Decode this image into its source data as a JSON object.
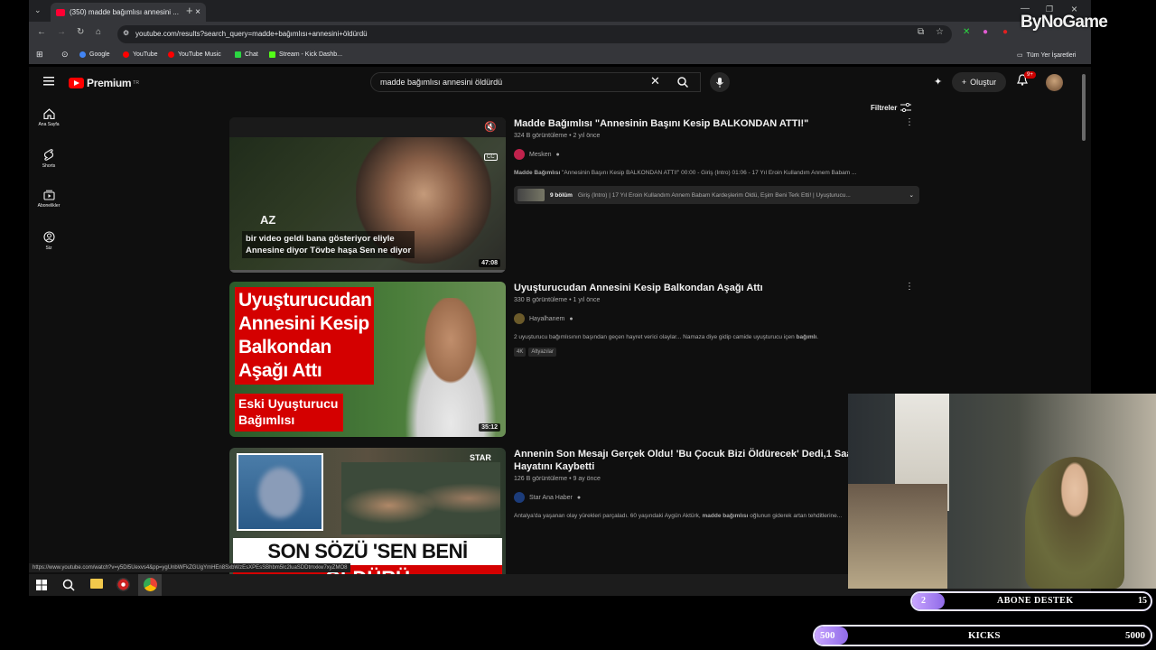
{
  "browser": {
    "tab_title": "(350) madde bağımlısı annesini ...",
    "url": "youtube.com/results?search_query=madde+bağımlısı+annesini+öldürdü",
    "bookmarks": [
      "Google",
      "YouTube",
      "YouTube Music",
      "Chat",
      "Stream - Kick Dashb..."
    ],
    "all_bookmarks": "Tüm Yer İşaretleri"
  },
  "youtube": {
    "logo_text": "Premium",
    "logo_sup": "TR",
    "search_query": "madde bağımlısı annesini öldürdü",
    "create_label": "Oluştur",
    "notif_count": "9+",
    "filters_label": "Filtreler",
    "sidebar": [
      {
        "label": "Ana Sayfa",
        "icon": "home-icon"
      },
      {
        "label": "Shorts",
        "icon": "shorts-icon"
      },
      {
        "label": "Abonelikler",
        "icon": "subscriptions-icon"
      },
      {
        "label": "Siz",
        "icon": "you-icon"
      }
    ],
    "results": [
      {
        "title": "Madde Bağımlısı \"Annesinin Başını Kesip BALKONDAN ATTI!\"",
        "meta": "324 B görüntüleme • 2 yıl önce",
        "channel": "Mesken",
        "desc_bold": "Madde Bağımlısı",
        "desc": " \"Annesinin Başını Kesip BALKONDAN ATTI!\" 00:00 - Giriş (İntro) 01:06 - 17 Yıl Eroin Kullandım Annem Babam ...",
        "chapters_count": "9 bölüm",
        "chapters_text": "Giriş (İntro) | 17 Yıl Eroin Kullandım Annem Babam Kardeşlerim Öldü, Eşim Beni Terk Etti! | Uyuşturucu...",
        "duration": "47:08",
        "thumb_caption_small": "AZ",
        "thumb_caption_1": "bir video geldi bana gösteriyor eliyle",
        "thumb_caption_2": "Annesine diyor Tövbe haşa Sen ne diyor"
      },
      {
        "title": "Uyuşturucudan Annesini Kesip Balkondan Aşağı Attı",
        "meta": "330 B görüntüleme • 1 yıl önce",
        "channel": "Hayalhanem",
        "desc": "2 uyuşturucu bağımlısının başından geçen hayret verici olaylar... Namaza diye gidip camide uyuşturucu içen ",
        "desc_bold": "bağımlı",
        "tags": [
          "4K",
          "Altyazılar"
        ],
        "duration": "35:12",
        "thumb_lines": [
          "Uyuşturucudan",
          "Annesini Kesip",
          "Balkondan",
          "Aşağı Attı"
        ],
        "thumb_sub": [
          "Eski Uyuşturucu",
          "Bağımlısı"
        ]
      },
      {
        "title": "Annenin Son Mesajı Gerçek Oldu! 'Bu Çocuk Bizi Öldürecek' Dedi,1 Saat Sonra Hayatını Kaybetti",
        "meta": "126 B görüntüleme • 9 ay önce",
        "channel": "Star Ana Haber",
        "desc": "Antalya'da yaşanan olay yürekleri parçaladı. 60 yaşındaki Aygün Aktürk, ",
        "desc_bold": "madde bağımlısı",
        "desc_end": " oğlunun giderek artan tehditlerine...",
        "thumb_text": "SON SÖZÜ 'SEN BENİ",
        "thumb_text2": "ÖLDÜRÜ",
        "thumb_logo": "STAR"
      }
    ],
    "status_url": "https://www.youtube.com/watch?v=y5Dl5Uexvs4&pp=ygUnbWFkZGUgYmHEn8SxbWzEsXPEsSBhbm5lc2luaSDDtmxkw7xyZMO8"
  },
  "overlay": {
    "brand": "ByNoGame",
    "sub_goal": {
      "label": "ABONE DESTEK",
      "current": "2",
      "target": "15",
      "fraction": 0.133
    },
    "kicks_goal": {
      "label": "KICKS",
      "current": "500",
      "target": "5000",
      "fraction": 0.1
    }
  },
  "colors": {
    "accent_red": "#ff0000",
    "purple_bar": "#b39bf5"
  }
}
